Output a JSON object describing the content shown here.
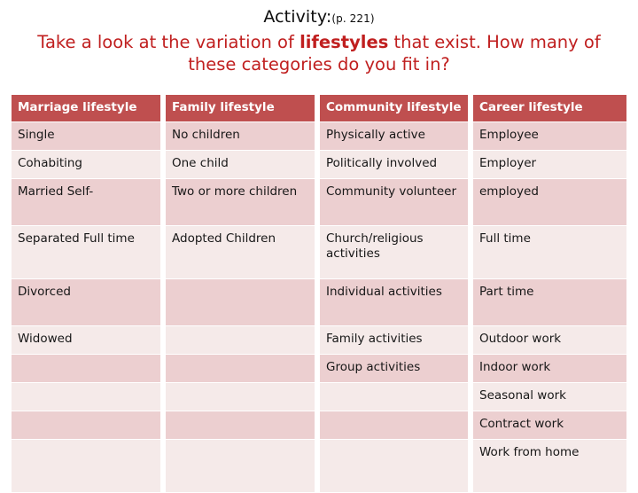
{
  "slide": {
    "title_main": "Activity:",
    "title_page_ref": "(p. 221)",
    "subtitle_part1": "Take a look at the variation of ",
    "subtitle_emphasis": "lifestyles",
    "subtitle_part2": " that exist. How many of these categories do you fit in?",
    "accent_red": "#c01f1f",
    "header_fill": "#bf4f4f",
    "row_fill_dark": "#eccfd0",
    "row_fill_light": "#f5eae9"
  },
  "table": {
    "headers": [
      "Marriage lifestyle",
      "Family lifestyle",
      "Community lifestyle",
      "Career lifestyle"
    ],
    "rows": [
      {
        "height_class": "h-1",
        "shade": "shade-dark",
        "cells": [
          "Single",
          "No children",
          "Physically active",
          "Employee"
        ]
      },
      {
        "height_class": "h-1",
        "shade": "shade-light",
        "cells": [
          "Cohabiting",
          "One child",
          "Politically involved",
          "Employer"
        ]
      },
      {
        "height_class": "h-2",
        "shade": "shade-dark",
        "cells": [
          "Married Self-",
          "Two or more children",
          "Community volunteer",
          "employed"
        ]
      },
      {
        "height_class": "h-3",
        "shade": "shade-light",
        "cells": [
          "Separated Full time",
          "Adopted Children",
          "Church/religious activities",
          "Full time"
        ]
      },
      {
        "height_class": "h-2",
        "shade": "shade-dark",
        "cells": [
          "Divorced",
          "",
          "Individual activities",
          "Part time"
        ]
      },
      {
        "height_class": "h-1",
        "shade": "shade-light",
        "cells": [
          "Widowed",
          "",
          "Family activities",
          "Outdoor work"
        ]
      },
      {
        "height_class": "h-1",
        "shade": "shade-dark",
        "cells": [
          "",
          "",
          "Group activities",
          "Indoor work"
        ]
      },
      {
        "height_class": "h-1",
        "shade": "shade-light",
        "cells": [
          "",
          "",
          "",
          "Seasonal work"
        ]
      },
      {
        "height_class": "h-1",
        "shade": "shade-dark",
        "cells": [
          "",
          "",
          "",
          "Contract work"
        ]
      },
      {
        "height_class": "h-3",
        "shade": "shade-light",
        "cells": [
          "",
          "",
          "",
          "Work from home"
        ]
      }
    ]
  }
}
